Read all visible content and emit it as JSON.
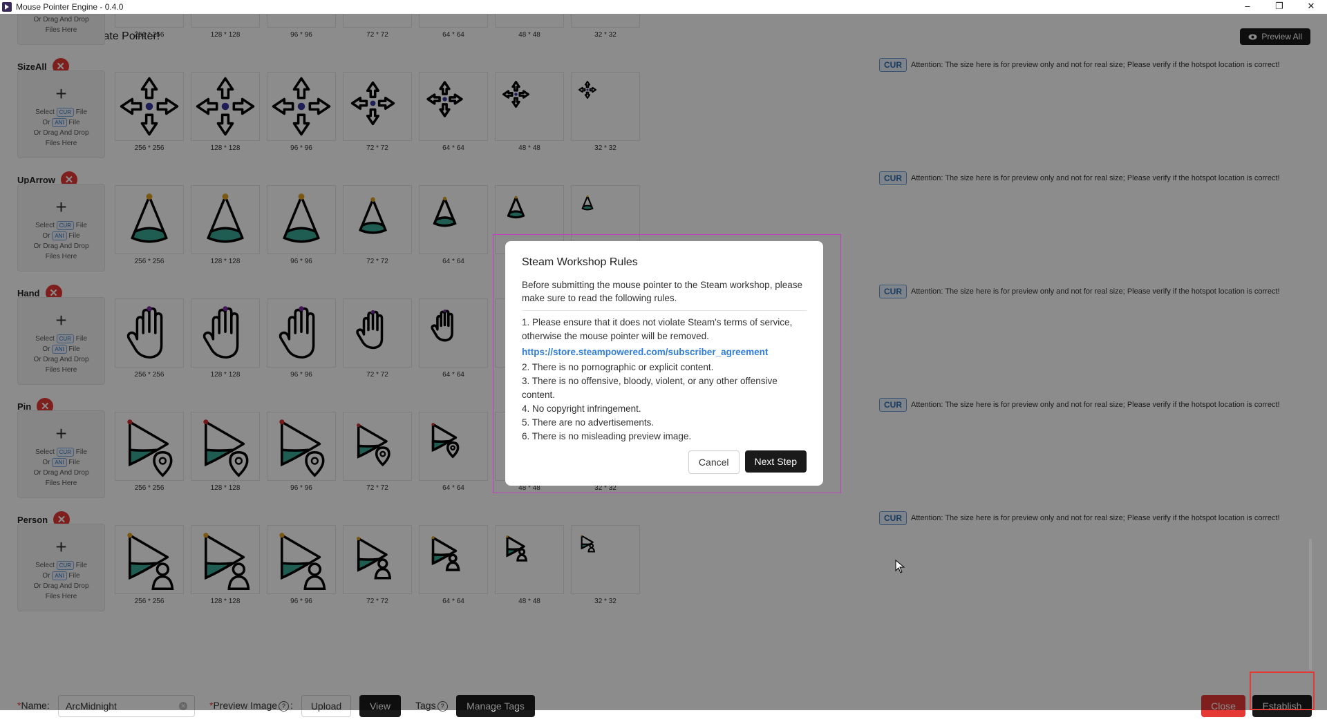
{
  "window": {
    "title": "Mouse Pointer Engine - 0.4.0",
    "controls": {
      "minimize": "–",
      "maximize": "❐",
      "close": "✕"
    }
  },
  "header": {
    "page_title": "My Pointers - Create Pointer!",
    "preview_all_label": "Preview All"
  },
  "drop_zone": {
    "select_prefix": "Select",
    "cur_badge": "CUR",
    "file_word": "File",
    "or_prefix": "Or",
    "ani_badge": "ANI",
    "drag_line": "Or Drag And Drop",
    "files_here": "Files Here",
    "plus": "+"
  },
  "sizes": [
    "256 * 256",
    "128 * 128",
    "96 * 96",
    "72 * 72",
    "64 * 64",
    "48 * 48",
    "32 * 32"
  ],
  "sections": [
    {
      "name": "",
      "icon": "arrow-icon",
      "remove": "✕"
    },
    {
      "name": "SizeAll",
      "icon": "move-arrows-icon",
      "remove": "✕",
      "cur_tag": "CUR"
    },
    {
      "name": "UpArrow",
      "icon": "up-arrow-cone-icon",
      "remove": "✕",
      "cur_tag": "CUR"
    },
    {
      "name": "Hand",
      "icon": "hand-icon",
      "remove": "✕",
      "cur_tag": "CUR"
    },
    {
      "name": "Pin",
      "icon": "pin-pointer-icon",
      "remove": "✕",
      "cur_tag": "CUR"
    },
    {
      "name": "Person",
      "icon": "person-pointer-icon",
      "remove": "✕",
      "cur_tag": "CUR"
    }
  ],
  "attention_text": "Attention: The size here is for preview only and not for real size; Please verify if the hotspot location is correct!",
  "dialog": {
    "title": "Steam Workshop Rules",
    "intro": "Before submitting the mouse pointer to the Steam workshop, please make sure to read the following rules.",
    "rules": [
      "1. Please ensure that it does not violate Steam's terms of service, otherwise the mouse pointer will be removed.",
      "2. There is no pornographic or explicit content.",
      "3. There is no offensive, bloody, violent, or any other offensive content.",
      "4. No copyright infringement.",
      "5. There are no advertisements.",
      "6. There is no misleading preview image."
    ],
    "link": "https://store.steampowered.com/subscriber_agreement",
    "cancel_label": "Cancel",
    "next_label": "Next Step"
  },
  "footer": {
    "required_mark": "*",
    "name_label": "Name:",
    "name_value": "ArcMidnight",
    "clear_icon": "✕",
    "preview_image_label": "Preview Image",
    "help_mark": "?",
    "colon": ":",
    "upload_label": "Upload",
    "view_label": "View",
    "tags_label": "Tags",
    "manage_tags_label": "Manage Tags",
    "close_label": "Close",
    "establish_label": "Establish"
  },
  "colors": {
    "accent_teal": "#3aaa98",
    "dot_orange": "#e0a020",
    "dot_blue": "#3a3aa0",
    "dot_purple": "#7a2aa0",
    "dot_red": "#d32f2f",
    "danger": "#e53935",
    "dark": "#1a1a1a"
  }
}
